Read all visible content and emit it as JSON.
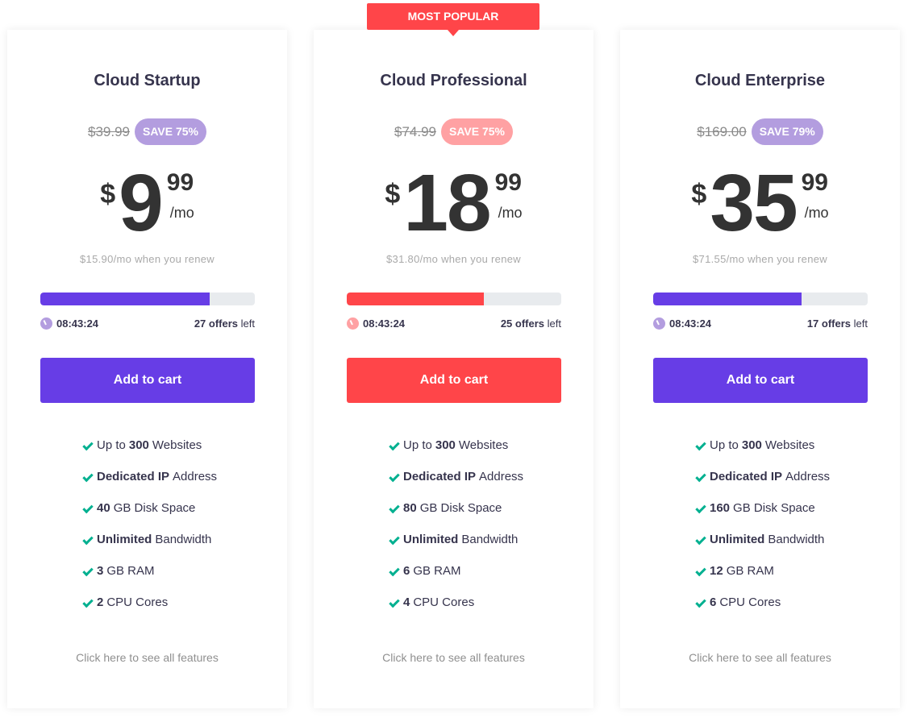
{
  "ribbon": {
    "label": "MOST POPULAR",
    "color": "#ff4549"
  },
  "plans": [
    {
      "name": "Cloud Startup",
      "old_price": "$39.99",
      "save_badge": "SAVE 75%",
      "badge_color": "#b39ddf",
      "currency": "$",
      "price_int": "9",
      "price_cents": "99",
      "period": "/mo",
      "renew_text": "$15.90/mo when you renew",
      "progress_percent": 79,
      "accent": "#673de6",
      "clock_color": "#b39ddf",
      "timer": "08:43:24",
      "offers_count": "27 offers",
      "offers_suffix": "left",
      "cta": "Add to cart",
      "features": [
        {
          "pre": "Up to",
          "bold": "300",
          "post": "Websites"
        },
        {
          "pre": "",
          "bold": "Dedicated IP",
          "post": "Address"
        },
        {
          "pre": "",
          "bold": "40",
          "post": "GB Disk Space"
        },
        {
          "pre": "",
          "bold": "Unlimited",
          "post": "Bandwidth"
        },
        {
          "pre": "",
          "bold": "3",
          "post": "GB RAM"
        },
        {
          "pre": "",
          "bold": "2",
          "post": "CPU Cores"
        }
      ],
      "see_all": "Click here to see all features"
    },
    {
      "name": "Cloud Professional",
      "old_price": "$74.99",
      "save_badge": "SAVE 75%",
      "badge_color": "#ffa1a3",
      "currency": "$",
      "price_int": "18",
      "price_cents": "99",
      "period": "/mo",
      "renew_text": "$31.80/mo when you renew",
      "progress_percent": 64,
      "accent": "#ff4549",
      "clock_color": "#ffa1a3",
      "timer": "08:43:24",
      "offers_count": "25 offers",
      "offers_suffix": "left",
      "cta": "Add to cart",
      "features": [
        {
          "pre": "Up to",
          "bold": "300",
          "post": "Websites"
        },
        {
          "pre": "",
          "bold": "Dedicated IP",
          "post": "Address"
        },
        {
          "pre": "",
          "bold": "80",
          "post": "GB Disk Space"
        },
        {
          "pre": "",
          "bold": "Unlimited",
          "post": "Bandwidth"
        },
        {
          "pre": "",
          "bold": "6",
          "post": "GB RAM"
        },
        {
          "pre": "",
          "bold": "4",
          "post": "CPU Cores"
        }
      ],
      "see_all": "Click here to see all features"
    },
    {
      "name": "Cloud Enterprise",
      "old_price": "$169.00",
      "save_badge": "SAVE 79%",
      "badge_color": "#b39ddf",
      "currency": "$",
      "price_int": "35",
      "price_cents": "99",
      "period": "/mo",
      "renew_text": "$71.55/mo when you renew",
      "progress_percent": 69,
      "accent": "#673de6",
      "clock_color": "#b39ddf",
      "timer": "08:43:24",
      "offers_count": "17 offers",
      "offers_suffix": "left",
      "cta": "Add to cart",
      "features": [
        {
          "pre": "Up to",
          "bold": "300",
          "post": "Websites"
        },
        {
          "pre": "",
          "bold": "Dedicated IP",
          "post": "Address"
        },
        {
          "pre": "",
          "bold": "160",
          "post": "GB Disk Space"
        },
        {
          "pre": "",
          "bold": "Unlimited",
          "post": "Bandwidth"
        },
        {
          "pre": "",
          "bold": "12",
          "post": "GB RAM"
        },
        {
          "pre": "",
          "bold": "6",
          "post": "CPU Cores"
        }
      ],
      "see_all": "Click here to see all features"
    }
  ]
}
